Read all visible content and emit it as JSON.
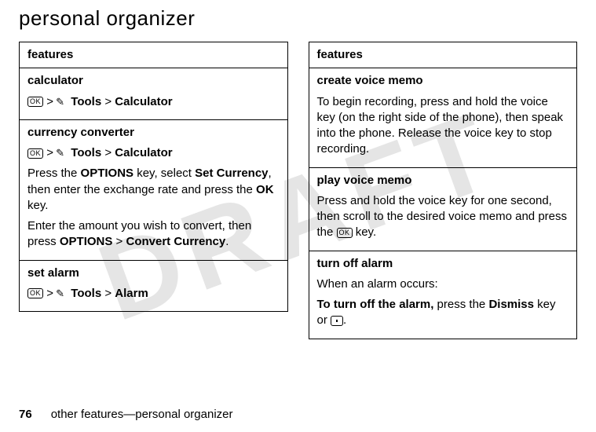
{
  "watermark": "DRAFT",
  "heading": "personal organizer",
  "footer": {
    "page": "76",
    "text": "other features—personal organizer"
  },
  "glyph": {
    "ok": "OK",
    "gt": ">"
  },
  "left": {
    "header": "features",
    "row1": {
      "title": "calculator",
      "tools": "Tools",
      "target": "Calculator"
    },
    "row2": {
      "title": "currency converter",
      "tools": "Tools",
      "target": "Calculator",
      "p1a": "Press the ",
      "p1b": "OPTIONS",
      "p1c": " key, select ",
      "p1d": "Set Currency",
      "p1e": ", then enter the exchange rate and press the ",
      "p1f": "OK",
      "p1g": " key.",
      "p2a": "Enter the amount you wish to convert, then press ",
      "p2b": "OPTIONS",
      "p2c": " > ",
      "p2d": "Convert Currency",
      "p2e": "."
    },
    "row3": {
      "title": "set alarm",
      "tools": "Tools",
      "target": "Alarm"
    }
  },
  "right": {
    "header": "features",
    "row1": {
      "title": "create voice memo",
      "p1": "To begin recording, press and hold the voice key (on the right side of the phone), then speak into the phone. Release the voice key to stop recording."
    },
    "row2": {
      "title": "play voice memo",
      "p1a": "Press and hold the voice key for one second, then scroll to the desired voice memo and press the ",
      "p1b": " key."
    },
    "row3": {
      "title": "turn off alarm",
      "p1": "When an alarm occurs:",
      "p2a": "To turn off the alarm,",
      "p2b": " press the ",
      "p2c": "Dismiss",
      "p2d": " key or ",
      "p2e": "."
    }
  }
}
